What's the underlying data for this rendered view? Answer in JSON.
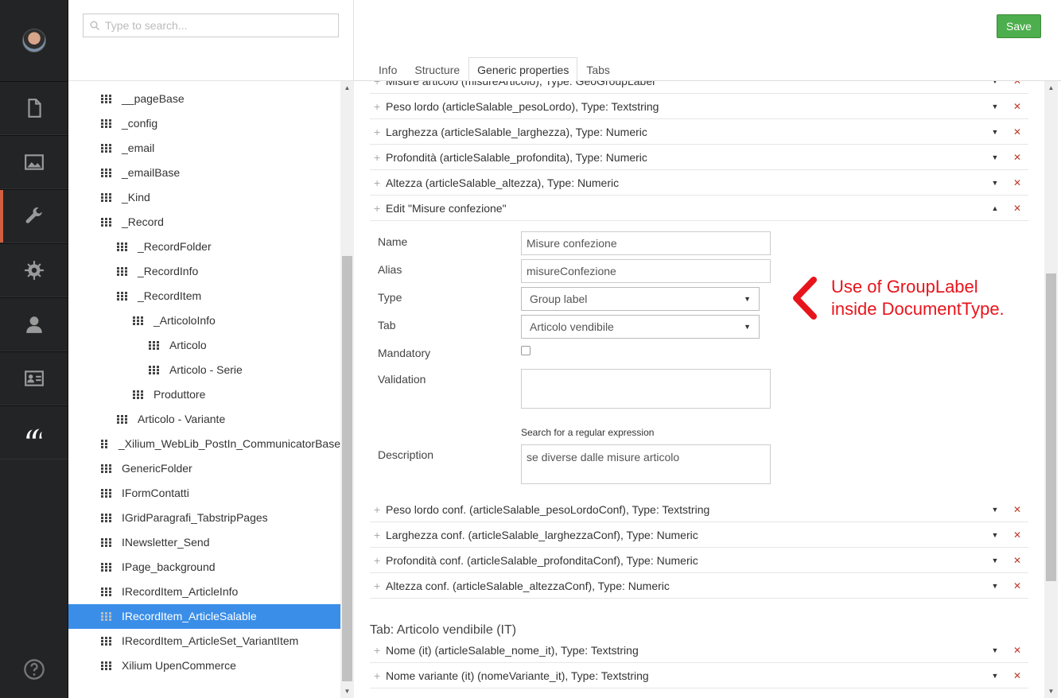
{
  "nav": {
    "items": [
      {
        "name": "document-icon",
        "active": false
      },
      {
        "name": "image-icon",
        "active": false
      },
      {
        "name": "wrench-icon",
        "active": true
      },
      {
        "name": "gear-icon",
        "active": false
      },
      {
        "name": "user-icon",
        "active": false
      },
      {
        "name": "id-card-icon",
        "active": false
      },
      {
        "name": "logo-icon",
        "active": false
      }
    ],
    "help_icon": "question-circle-icon"
  },
  "search": {
    "placeholder": "Type to search..."
  },
  "tree": [
    {
      "label": "__pageBase",
      "level": 0
    },
    {
      "label": "_config",
      "level": 0
    },
    {
      "label": "_email",
      "level": 0
    },
    {
      "label": "_emailBase",
      "level": 0
    },
    {
      "label": "_Kind",
      "level": 0
    },
    {
      "label": "_Record",
      "level": 0
    },
    {
      "label": "_RecordFolder",
      "level": 1
    },
    {
      "label": "_RecordInfo",
      "level": 1
    },
    {
      "label": "_RecordItem",
      "level": 1
    },
    {
      "label": "_ArticoloInfo",
      "level": 2
    },
    {
      "label": "Articolo",
      "level": 3
    },
    {
      "label": "Articolo - Serie",
      "level": 3
    },
    {
      "label": "Produttore",
      "level": 2
    },
    {
      "label": "Articolo - Variante",
      "level": 1
    },
    {
      "label": "_Xilium_WebLib_PostIn_CommunicatorBase",
      "level": 0
    },
    {
      "label": "GenericFolder",
      "level": 0
    },
    {
      "label": "IFormContatti",
      "level": 0
    },
    {
      "label": "IGridParagrafi_TabstripPages",
      "level": 0
    },
    {
      "label": "INewsletter_Send",
      "level": 0
    },
    {
      "label": "IPage_background",
      "level": 0
    },
    {
      "label": "IRecordItem_ArticleInfo",
      "level": 0
    },
    {
      "label": "IRecordItem_ArticleSalable",
      "level": 0,
      "selected": true
    },
    {
      "label": "IRecordItem_ArticleSet_VariantItem",
      "level": 0
    },
    {
      "label": "Xilium UpenCommerce",
      "level": 0
    }
  ],
  "toolbar": {
    "save_label": "Save"
  },
  "tabs": [
    "Info",
    "Structure",
    "Generic properties",
    "Tabs"
  ],
  "active_tab": "Generic properties",
  "properties_top": [
    "Misure articolo (misureArticolo), Type: GeoGroupLabel",
    "Peso lordo (articleSalable_pesoLordo), Type: Textstring",
    "Larghezza (articleSalable_larghezza), Type: Numeric",
    "Profondità (articleSalable_profondita), Type: Numeric",
    "Altezza (articleSalable_altezza), Type: Numeric"
  ],
  "edit": {
    "title": "Edit \"Misure confezione\"",
    "name_label": "Name",
    "name_value": "Misure confezione",
    "alias_label": "Alias",
    "alias_value": "misureConfezione",
    "type_label": "Type",
    "type_value": "Group label",
    "tab_label": "Tab",
    "tab_value": "Articolo vendibile",
    "mandatory_label": "Mandatory",
    "mandatory_checked": false,
    "validation_label": "Validation",
    "validation_value": "",
    "validation_hint": "Search for a regular expression",
    "description_label": "Description",
    "description_value": "se diverse dalle misure articolo"
  },
  "properties_bottom": [
    "Peso lordo conf. (articleSalable_pesoLordoConf), Type: Textstring",
    "Larghezza conf. (articleSalable_larghezzaConf), Type: Numeric",
    "Profondità conf. (articleSalable_profonditaConf), Type: Numeric",
    "Altezza conf. (articleSalable_altezzaConf), Type: Numeric"
  ],
  "tab_section": {
    "title": "Tab: Articolo vendibile (IT)",
    "properties": [
      "Nome (it) (articleSalable_nome_it), Type: Textstring",
      "Nome variante (it) (nomeVariante_it), Type: Textstring"
    ]
  },
  "annotation": {
    "line1": "Use of GroupLabel",
    "line2": "inside DocumentType.",
    "color": "#e8141b"
  },
  "colors": {
    "accent": "#3a8ee8",
    "save": "#4cae4c",
    "nav_active": "#d35f42",
    "delete": "#c0392b"
  }
}
